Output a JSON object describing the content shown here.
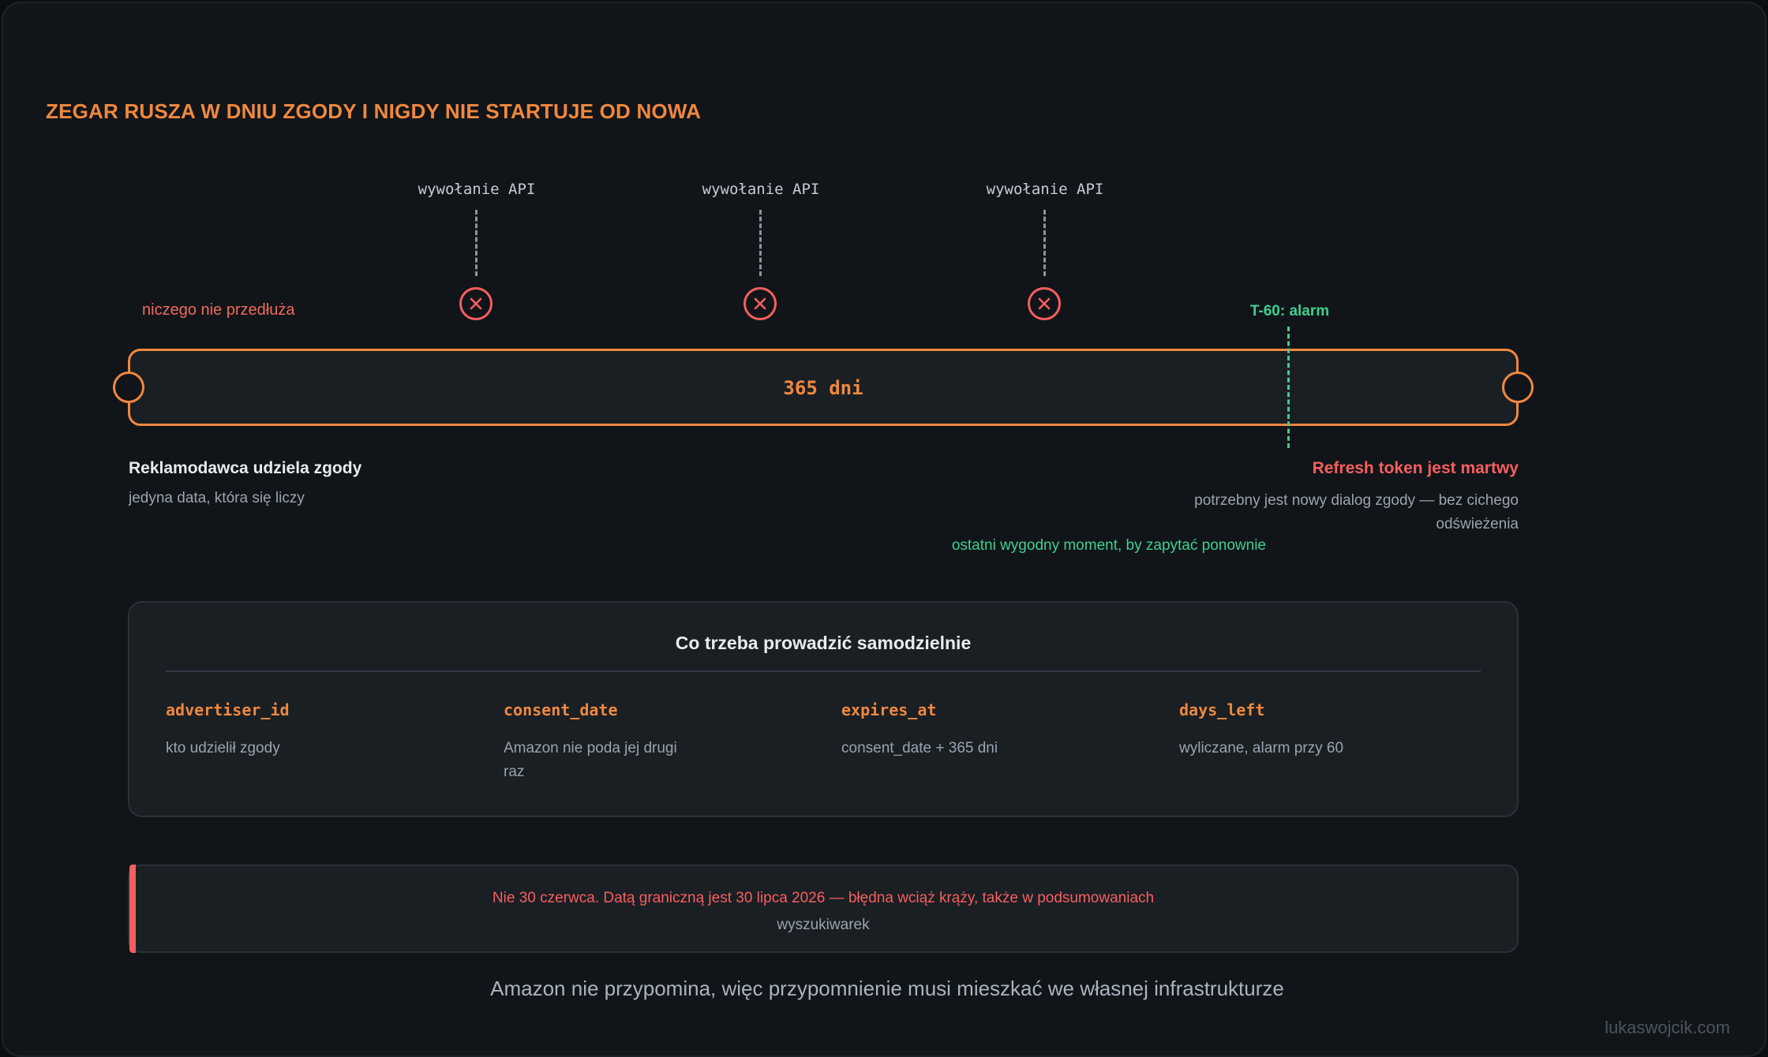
{
  "title": "ZEGAR RUSZA W DNIU ZGODY I NIGDY NIE STARTUJE OD NOWA",
  "api_calls": [
    {
      "label": "wywołanie API"
    },
    {
      "label": "wywołanie API"
    },
    {
      "label": "wywołanie API"
    }
  ],
  "api_note": "niczego nie przedłuża",
  "alarm": {
    "label": "T-60: alarm",
    "note": "ostatni wygodny moment, by zapytać ponownie"
  },
  "timeline": {
    "duration_label": "365 dni",
    "start": {
      "heading": "Reklamodawca udziela zgody",
      "sub": "jedyna data, która się liczy"
    },
    "end": {
      "heading": "Refresh token jest martwy",
      "sub": "potrzebny jest nowy dialog zgody — bez cichego odświeżenia"
    }
  },
  "tracking": {
    "title": "Co trzeba prowadzić samodzielnie",
    "fields": [
      {
        "key": "advertiser_id",
        "desc": "kto udzielił zgody"
      },
      {
        "key": "consent_date",
        "desc": "Amazon nie poda jej drugi raz"
      },
      {
        "key": "expires_at",
        "desc": "consent_date + 365 dni"
      },
      {
        "key": "days_left",
        "desc": "wyliczane, alarm przy 60"
      }
    ]
  },
  "warning": {
    "text_red": "Nie 30 czerwca. Datą graniczną jest 30 lipca 2026 — błędna wciąż krąży, także w podsumowaniach",
    "text_grey": "wyszukiwarek"
  },
  "footer": "Amazon nie przypomina, więc przypomnienie musi mieszkać we własnej infrastrukturze",
  "credit": "lukaswojcik.com",
  "colors": {
    "accent": "#f0883e",
    "danger": "#f85e5e",
    "success": "#3fcf8e",
    "background": "#111519"
  }
}
